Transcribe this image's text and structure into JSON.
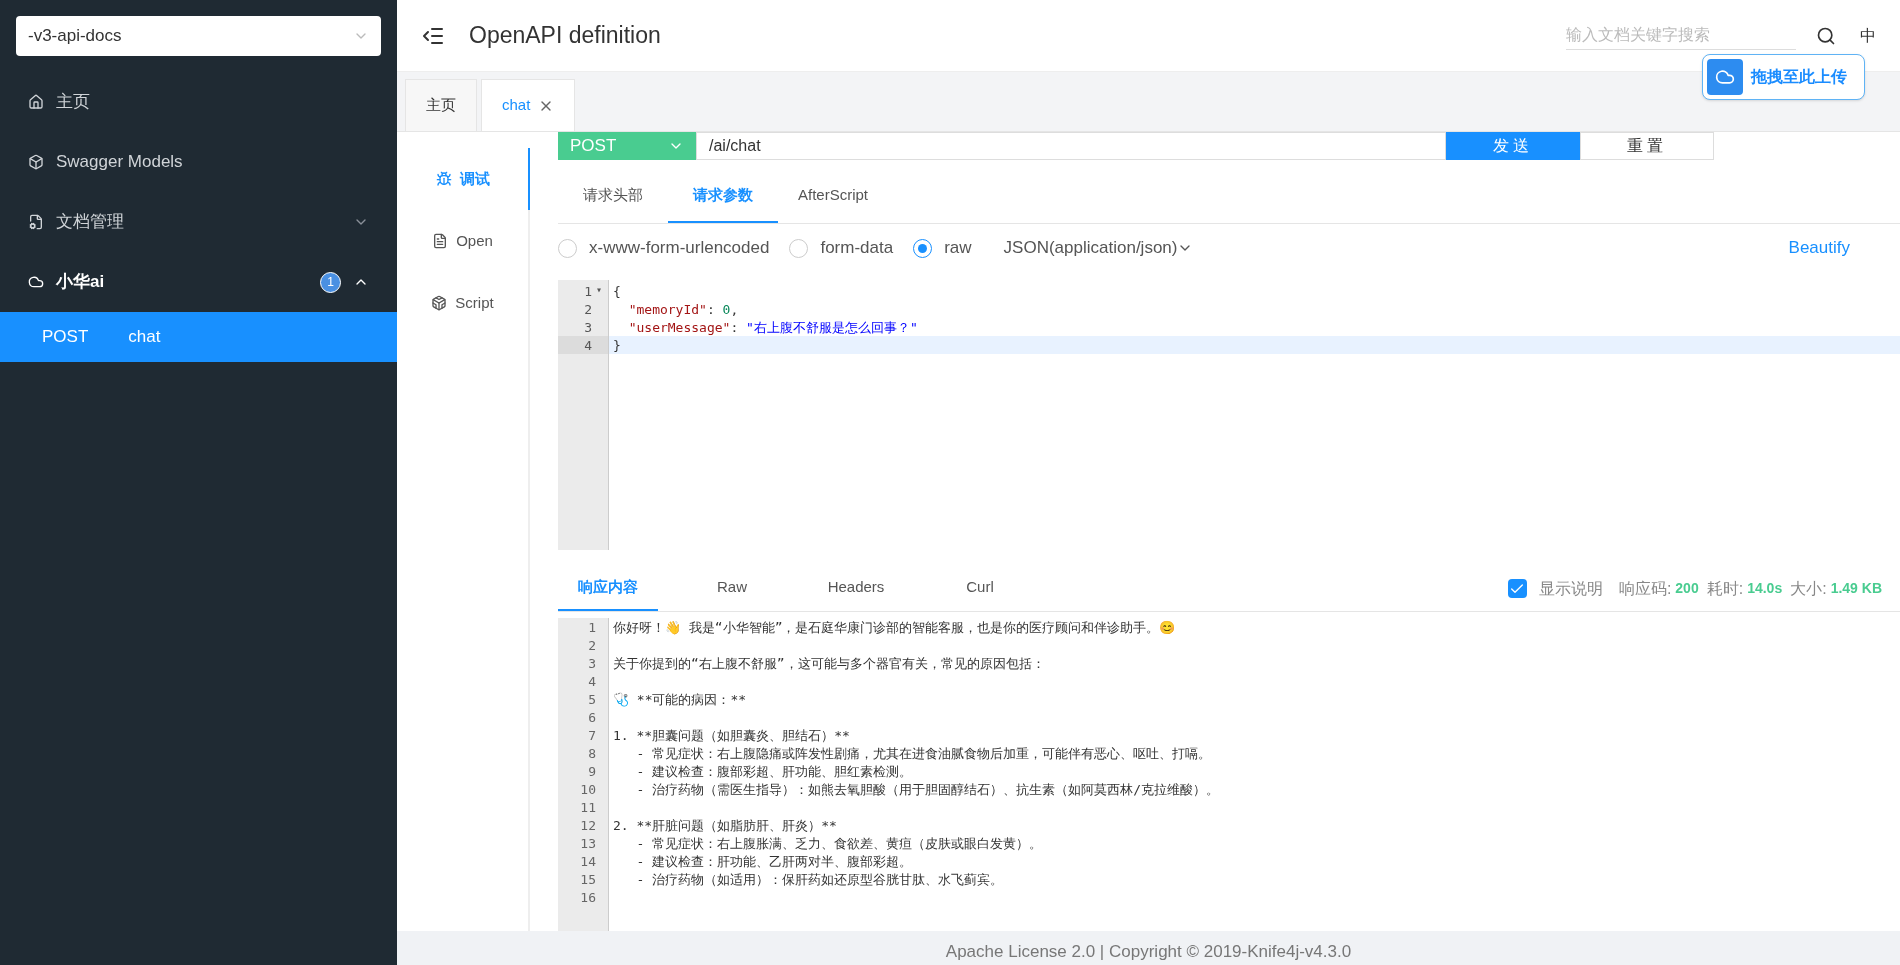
{
  "sidebar": {
    "group_select": {
      "value": "-v3-api-docs"
    },
    "items": [
      {
        "kind": "home",
        "label": "主页",
        "expanded": false
      },
      {
        "kind": "models",
        "label": "Swagger Models",
        "expanded": false
      },
      {
        "kind": "docs",
        "label": "文档管理",
        "expanded": false,
        "has_children": true
      },
      {
        "kind": "cloud",
        "label": "小华ai",
        "expanded": true,
        "has_children": true,
        "badge": "1",
        "children": [
          {
            "method": "POST",
            "label": "chat",
            "selected": true
          }
        ]
      }
    ]
  },
  "header": {
    "title": "OpenAPI definition",
    "search": {
      "placeholder": "输入文档关键字搜索"
    },
    "language": "中",
    "upload_widget": "拖拽至此上传"
  },
  "tabs": [
    {
      "label": "主页",
      "selected": false,
      "closable": false
    },
    {
      "label": "chat",
      "selected": true,
      "closable": true
    }
  ],
  "side_tabs": [
    {
      "kind": "debug",
      "label": "调试",
      "selected": true
    },
    {
      "kind": "doc",
      "label": "Open",
      "selected": false
    },
    {
      "kind": "script",
      "label": "Script",
      "selected": false
    }
  ],
  "request": {
    "method": "POST",
    "url": "/ai/chat",
    "buttons": [
      "发送",
      "重置"
    ]
  },
  "param_tabs": [
    {
      "label": "请求头部",
      "selected": false
    },
    {
      "label": "请求参数",
      "selected": true
    },
    {
      "label": "AfterScript",
      "selected": false
    }
  ],
  "body_types": [
    {
      "label": "x-www-form-urlencoded",
      "selected": false
    },
    {
      "label": "form-data",
      "selected": false
    },
    {
      "label": "raw",
      "selected": true
    }
  ],
  "content_type": "JSON(application/json)",
  "beautify": "Beautify",
  "request_editor": [
    {
      "number": "1",
      "active": false,
      "fold_marker": "▾",
      "segments": [
        {
          "kind": "punct",
          "text": "{"
        }
      ]
    },
    {
      "number": "2",
      "active": false,
      "segments": [
        {
          "kind": "key",
          "text": "  \"memoryId\""
        },
        {
          "kind": "punct",
          "text": ": "
        },
        {
          "kind": "number",
          "text": "0"
        },
        {
          "kind": "punct",
          "text": ","
        }
      ]
    },
    {
      "number": "3",
      "active": false,
      "segments": [
        {
          "kind": "key",
          "text": "  \"userMessage\""
        },
        {
          "kind": "punct",
          "text": ": "
        },
        {
          "kind": "string",
          "text": "\"右上腹不舒服是怎么回事？\""
        }
      ]
    },
    {
      "number": "4",
      "active": true,
      "segments": [
        {
          "kind": "punct",
          "text": "}"
        }
      ]
    }
  ],
  "response_tabs": [
    {
      "label": "响应内容",
      "selected": true
    },
    {
      "label": "Raw",
      "selected": false
    },
    {
      "label": "Headers",
      "selected": false
    },
    {
      "label": "Curl",
      "selected": false
    }
  ],
  "show_description": {
    "label": "显示说明",
    "checked": true
  },
  "response_stats": [
    {
      "label": "响应码:",
      "value": "200"
    },
    {
      "label": "耗时:",
      "value": "14.0s"
    },
    {
      "label": "大小:",
      "value": "1.49 KB"
    }
  ],
  "response_editor": [
    {
      "number": "1",
      "text": "你好呀！👋 我是“小华智能”，是石庭华康门诊部的智能客服，也是你的医疗顾问和伴诊助手。😊"
    },
    {
      "number": "2"
    },
    {
      "number": "3",
      "text": "关于你提到的“右上腹不舒服”，这可能与多个器官有关，常见的原因包括："
    },
    {
      "number": "4"
    },
    {
      "number": "5",
      "text": "🩺 **可能的病因：**"
    },
    {
      "number": "6"
    },
    {
      "number": "7",
      "text": "1. **胆囊问题（如胆囊炎、胆结石）**"
    },
    {
      "number": "8",
      "text": "   - 常见症状：右上腹隐痛或阵发性剧痛，尤其在进食油腻食物后加重，可能伴有恶心、呕吐、打嗝。"
    },
    {
      "number": "9",
      "text": "   - 建议检查：腹部彩超、肝功能、胆红素检测。"
    },
    {
      "number": "10",
      "text": "   - 治疗药物（需医生指导）：如熊去氧胆酸（用于胆固醇结石）、抗生素（如阿莫西林/克拉维酸）。"
    },
    {
      "number": "11"
    },
    {
      "number": "12",
      "text": "2. **肝脏问题（如脂肪肝、肝炎）**"
    },
    {
      "number": "13",
      "text": "   - 常见症状：右上腹胀满、乏力、食欲差、黄疸（皮肤或眼白发黄）。"
    },
    {
      "number": "14",
      "text": "   - 建议检查：肝功能、乙肝两对半、腹部彩超。"
    },
    {
      "number": "15",
      "text": "   - 治疗药物（如适用）：保肝药如还原型谷胱甘肽、水飞蓟宾。"
    },
    {
      "number": "16"
    }
  ],
  "footer": "Apache License 2.0 | Copyright © 2019-Knife4j-v4.3.0"
}
